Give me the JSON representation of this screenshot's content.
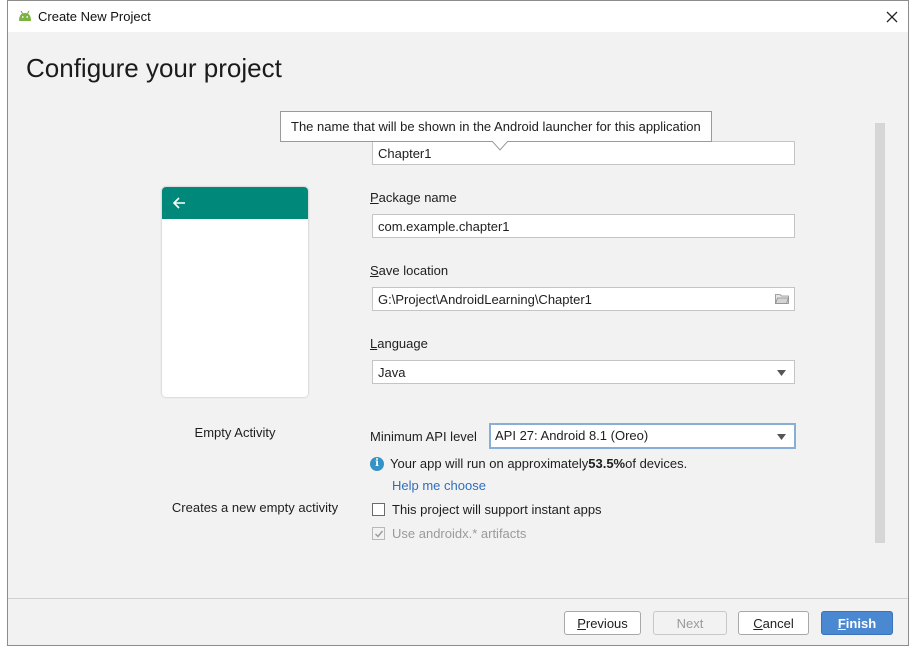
{
  "window": {
    "title": "Create New Project",
    "close_symbol": "✕"
  },
  "header": {
    "title": "Configure your project"
  },
  "template": {
    "name": "Empty Activity",
    "description": "Creates a new empty activity"
  },
  "tooltip": {
    "text": "The name that will be shown in the Android launcher for this application"
  },
  "form": {
    "name_value": "Chapter1",
    "package_label_mnemonic": "P",
    "package_label_rest": "ackage name",
    "package_value": "com.example.chapter1",
    "save_label_mnemonic": "S",
    "save_label_rest": "ave location",
    "save_value": "G:\\Project\\AndroidLearning\\Chapter1",
    "language_label_mnemonic": "L",
    "language_label_rest": "anguage",
    "language_value": "Java",
    "min_api_label": "Minimum API level",
    "min_api_value": "API 27: Android 8.1 (Oreo)",
    "info_prefix": "Your app will run on approximately ",
    "info_percent": "53.5%",
    "info_suffix": " of devices.",
    "help_link": "Help me choose",
    "instant_apps_label": "This project will support instant apps",
    "instant_apps_checked": false,
    "androidx_label": "Use androidx.* artifacts",
    "androidx_checked": true
  },
  "buttons": {
    "previous_mnemonic": "P",
    "previous_rest": "revious",
    "next": "Next",
    "cancel_mnemonic": "C",
    "cancel_rest": "ancel",
    "finish_mnemonic": "F",
    "finish_rest": "inish"
  },
  "colors": {
    "accent": "#4a88d2",
    "toolbar_teal": "#00897b",
    "link": "#2e6fbd",
    "info": "#3592c4"
  }
}
